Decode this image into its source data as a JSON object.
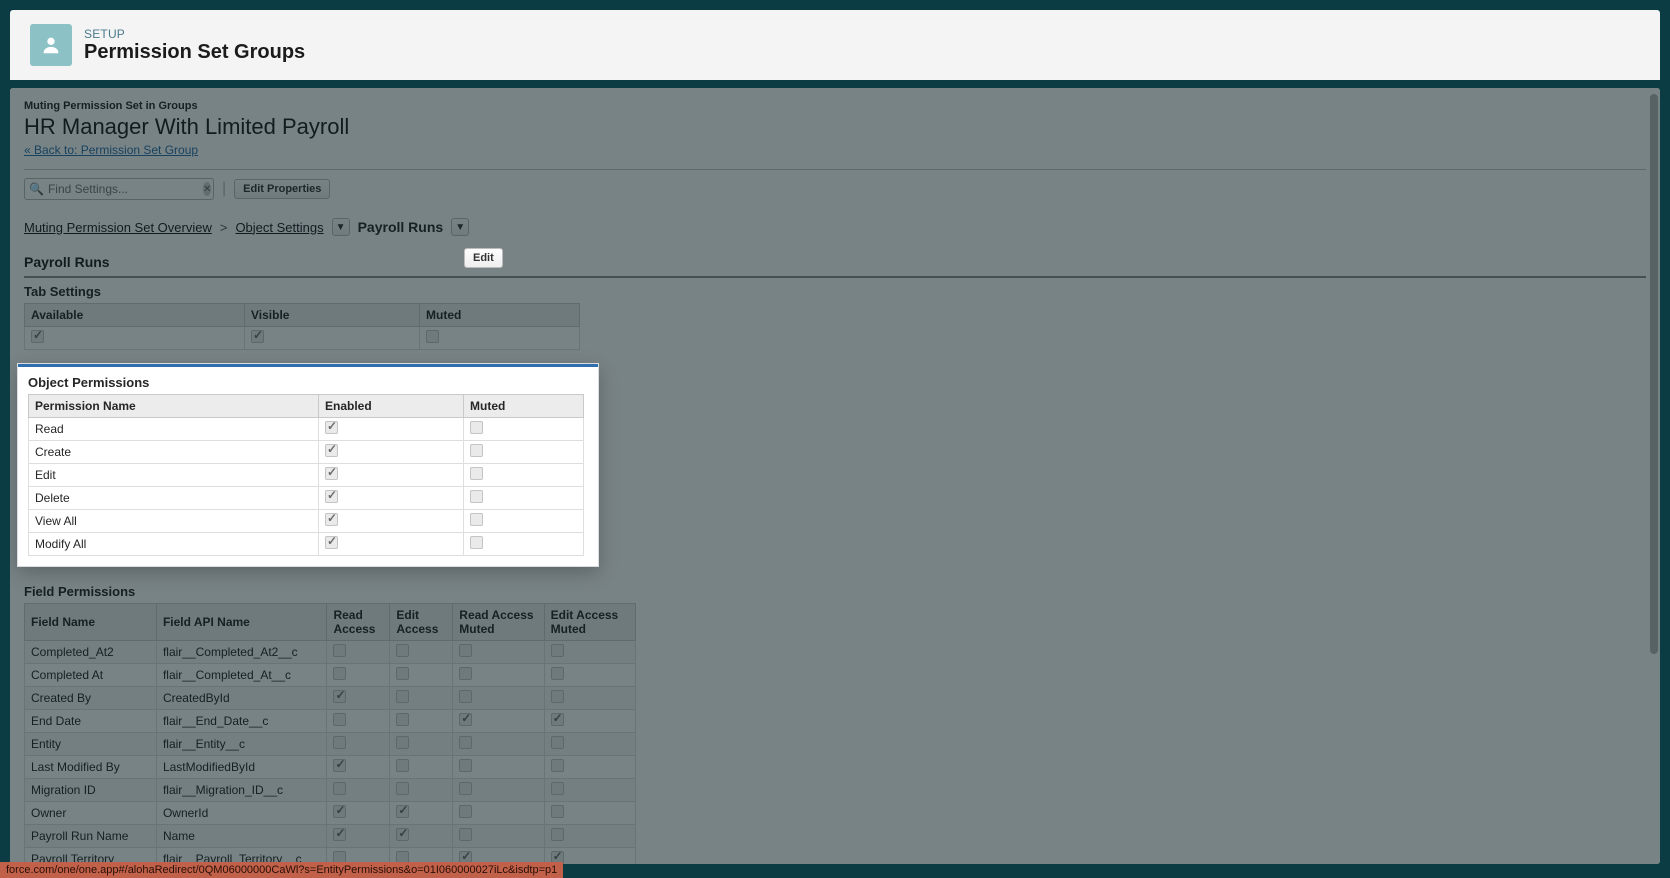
{
  "header": {
    "eyebrow": "SETUP",
    "title": "Permission Set Groups"
  },
  "page": {
    "muting_eyebrow": "Muting Permission Set in Groups",
    "title": "HR Manager With Limited Payroll",
    "backlink": "« Back to: Permission Set Group"
  },
  "toolbar": {
    "search_placeholder": "Find Settings...",
    "edit_properties": "Edit Properties"
  },
  "breadcrumb": {
    "overview": "Muting Permission Set Overview",
    "object_settings": "Object Settings",
    "current": "Payroll Runs",
    "sep": ">"
  },
  "section": {
    "title": "Payroll Runs",
    "edit_btn": "Edit"
  },
  "tab_settings": {
    "title": "Tab Settings",
    "headers": [
      "Available",
      "Visible",
      "Muted"
    ],
    "row": {
      "available": true,
      "visible": true,
      "muted": false
    }
  },
  "object_permissions": {
    "title": "Object Permissions",
    "headers": [
      "Permission Name",
      "Enabled",
      "Muted"
    ],
    "rows": [
      {
        "name": "Read",
        "enabled": true,
        "muted": false
      },
      {
        "name": "Create",
        "enabled": true,
        "muted": false
      },
      {
        "name": "Edit",
        "enabled": true,
        "muted": false
      },
      {
        "name": "Delete",
        "enabled": true,
        "muted": false
      },
      {
        "name": "View All",
        "enabled": true,
        "muted": false
      },
      {
        "name": "Modify All",
        "enabled": true,
        "muted": false
      }
    ]
  },
  "field_permissions": {
    "title": "Field Permissions",
    "headers": [
      "Field Name",
      "Field API Name",
      "Read Access",
      "Edit Access",
      "Read Access Muted",
      "Edit Access Muted"
    ],
    "rows": [
      {
        "field": "Completed_At2",
        "api": "flair__Completed_At2__c",
        "ra": false,
        "ea": false,
        "ram": false,
        "eam": false
      },
      {
        "field": "Completed At",
        "api": "flair__Completed_At__c",
        "ra": false,
        "ea": false,
        "ram": false,
        "eam": false
      },
      {
        "field": "Created By",
        "api": "CreatedById",
        "ra": true,
        "ea": false,
        "ram": false,
        "eam": false
      },
      {
        "field": "End Date",
        "api": "flair__End_Date__c",
        "ra": false,
        "ea": false,
        "ram": true,
        "eam": true
      },
      {
        "field": "Entity",
        "api": "flair__Entity__c",
        "ra": false,
        "ea": false,
        "ram": false,
        "eam": false
      },
      {
        "field": "Last Modified By",
        "api": "LastModifiedById",
        "ra": true,
        "ea": false,
        "ram": false,
        "eam": false
      },
      {
        "field": "Migration ID",
        "api": "flair__Migration_ID__c",
        "ra": false,
        "ea": false,
        "ram": false,
        "eam": false
      },
      {
        "field": "Owner",
        "api": "OwnerId",
        "ra": true,
        "ea": true,
        "ram": false,
        "eam": false
      },
      {
        "field": "Payroll Run Name",
        "api": "Name",
        "ra": true,
        "ea": true,
        "ram": false,
        "eam": false
      },
      {
        "field": "Payroll Territory",
        "api": "flair__Payroll_Territory__c",
        "ra": false,
        "ea": false,
        "ram": true,
        "eam": true
      }
    ]
  },
  "url_strip": "force.com/one/one.app#/alohaRedirect/0QM06000000CaWl?s=EntityPermissions&o=01I060000027iLc&isdtp=p1"
}
